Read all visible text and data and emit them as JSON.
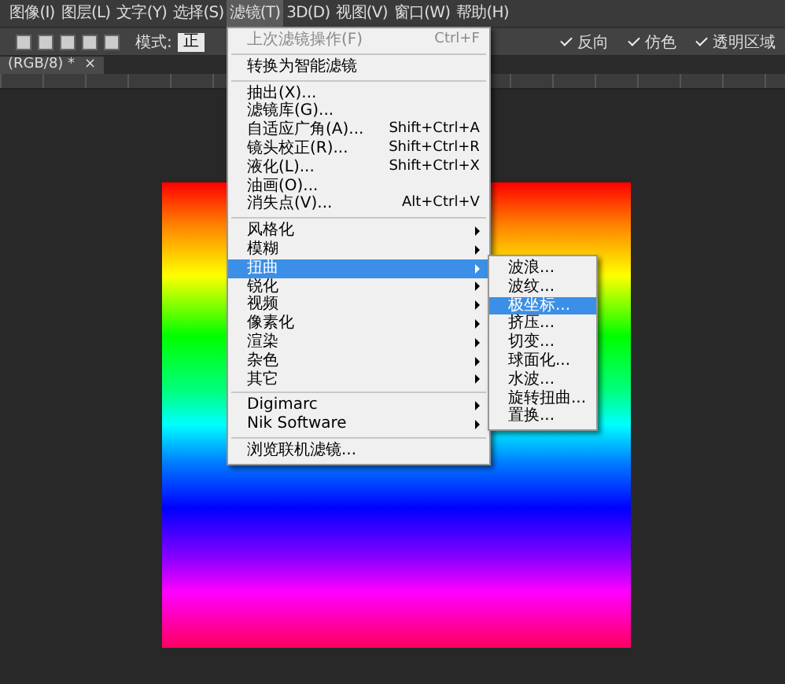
{
  "menubar": [
    {
      "label": "图像(I)",
      "selected": false
    },
    {
      "label": "图层(L)",
      "selected": false
    },
    {
      "label": "文字(Y)",
      "selected": false
    },
    {
      "label": "选择(S)",
      "selected": false
    },
    {
      "label": "滤镜(T)",
      "selected": true
    },
    {
      "label": "3D(D)",
      "selected": false
    },
    {
      "label": "视图(V)",
      "selected": false
    },
    {
      "label": "窗口(W)",
      "selected": false
    },
    {
      "label": "帮助(H)",
      "selected": false
    }
  ],
  "options_bar": {
    "mode_label": "模式:",
    "mode_value": "正",
    "checks": [
      {
        "label": "反向",
        "checked": true
      },
      {
        "label": "仿色",
        "checked": true
      },
      {
        "label": "透明区域",
        "checked": true
      }
    ]
  },
  "document_tab": {
    "title": "(RGB/8) *",
    "close": "×"
  },
  "filter_menu": [
    {
      "kind": "item",
      "label": "上次滤镜操作(F)",
      "shortcut": "Ctrl+F",
      "disabled": true,
      "selected": false
    },
    {
      "kind": "separator"
    },
    {
      "kind": "item",
      "label": "转换为智能滤镜",
      "disabled": false,
      "selected": false
    },
    {
      "kind": "separator"
    },
    {
      "kind": "item",
      "label": "抽出(X)...",
      "disabled": false,
      "selected": false
    },
    {
      "kind": "item",
      "label": "滤镜库(G)...",
      "disabled": false,
      "selected": false
    },
    {
      "kind": "item",
      "label": "自适应广角(A)...",
      "shortcut": "Shift+Ctrl+A",
      "disabled": false,
      "selected": false
    },
    {
      "kind": "item",
      "label": "镜头校正(R)...",
      "shortcut": "Shift+Ctrl+R",
      "disabled": false,
      "selected": false
    },
    {
      "kind": "item",
      "label": "液化(L)...",
      "shortcut": "Shift+Ctrl+X",
      "disabled": false,
      "selected": false
    },
    {
      "kind": "item",
      "label": "油画(O)...",
      "disabled": false,
      "selected": false
    },
    {
      "kind": "item",
      "label": "消失点(V)...",
      "shortcut": "Alt+Ctrl+V",
      "disabled": false,
      "selected": false
    },
    {
      "kind": "separator"
    },
    {
      "kind": "submenu",
      "label": "风格化",
      "disabled": false,
      "selected": false
    },
    {
      "kind": "submenu",
      "label": "模糊",
      "disabled": false,
      "selected": false
    },
    {
      "kind": "submenu",
      "label": "扭曲",
      "disabled": false,
      "selected": true
    },
    {
      "kind": "submenu",
      "label": "锐化",
      "disabled": false,
      "selected": false
    },
    {
      "kind": "submenu",
      "label": "视频",
      "disabled": false,
      "selected": false
    },
    {
      "kind": "submenu",
      "label": "像素化",
      "disabled": false,
      "selected": false
    },
    {
      "kind": "submenu",
      "label": "渲染",
      "disabled": false,
      "selected": false
    },
    {
      "kind": "submenu",
      "label": "杂色",
      "disabled": false,
      "selected": false
    },
    {
      "kind": "submenu",
      "label": "其它",
      "disabled": false,
      "selected": false
    },
    {
      "kind": "separator"
    },
    {
      "kind": "submenu",
      "label": "Digimarc",
      "disabled": false,
      "selected": false
    },
    {
      "kind": "submenu",
      "label": "Nik Software",
      "disabled": false,
      "selected": false
    },
    {
      "kind": "separator"
    },
    {
      "kind": "item",
      "label": "浏览联机滤镜...",
      "disabled": false,
      "selected": false
    }
  ],
  "distort_submenu": [
    {
      "kind": "item",
      "label": "波浪...",
      "disabled": false,
      "selected": false
    },
    {
      "kind": "item",
      "label": "波纹...",
      "disabled": false,
      "selected": false
    },
    {
      "kind": "item",
      "label": "极坐标...",
      "disabled": false,
      "selected": true
    },
    {
      "kind": "item",
      "label": "挤压...",
      "disabled": false,
      "selected": false
    },
    {
      "kind": "item",
      "label": "切变...",
      "disabled": false,
      "selected": false
    },
    {
      "kind": "item",
      "label": "球面化...",
      "disabled": false,
      "selected": false
    },
    {
      "kind": "item",
      "label": "水波...",
      "disabled": false,
      "selected": false
    },
    {
      "kind": "item",
      "label": "旋转扭曲...",
      "disabled": false,
      "selected": false
    },
    {
      "kind": "item",
      "label": "置换...",
      "disabled": false,
      "selected": false
    }
  ]
}
